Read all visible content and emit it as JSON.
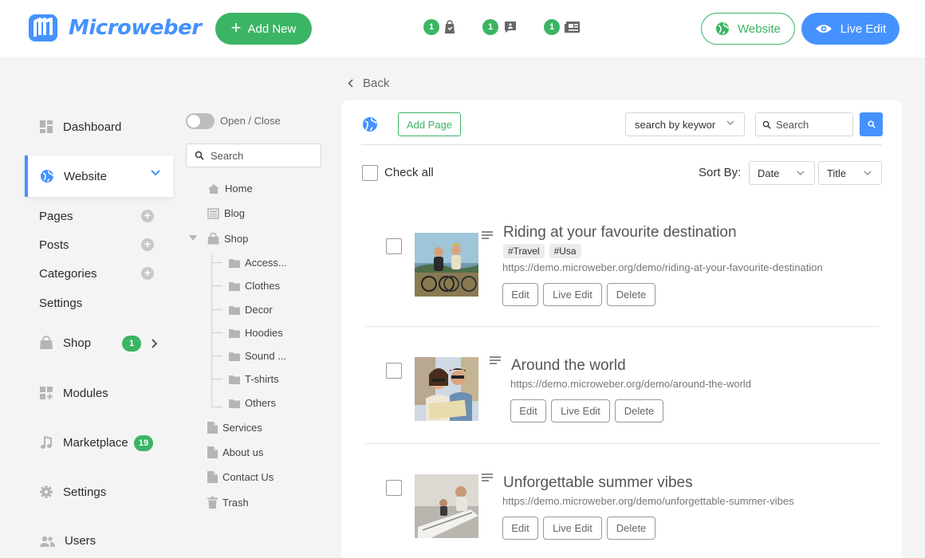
{
  "brand": {
    "name": "Microweber",
    "color": "#4592ff"
  },
  "topbar": {
    "add_new_label": "Add New",
    "notifications": [
      {
        "count": "1",
        "icon": "shop-bag-icon"
      },
      {
        "count": "1",
        "icon": "comment-icon"
      },
      {
        "count": "1",
        "icon": "newspaper-icon"
      }
    ],
    "website_label": "Website",
    "live_edit_label": "Live Edit"
  },
  "sidebar": {
    "dashboard": "Dashboard",
    "website": "Website",
    "website_sub": {
      "pages": "Pages",
      "posts": "Posts",
      "categories": "Categories",
      "settings": "Settings"
    },
    "shop": "Shop",
    "shop_badge": "1",
    "modules": "Modules",
    "marketplace": "Marketplace",
    "marketplace_badge": "19",
    "settings": "Settings",
    "users": "Users"
  },
  "tree": {
    "toggle_label": "Open / Close",
    "search_placeholder": "Search",
    "items": {
      "home": "Home",
      "blog": "Blog",
      "shop": "Shop",
      "access": "Access...",
      "clothes": "Clothes",
      "decor": "Decor",
      "hoodies": "Hoodies",
      "sound": "Sound ...",
      "tshirts": "T-shirts",
      "others": "Others",
      "services": "Services",
      "about": "About us",
      "contact": "Contact Us",
      "trash": "Trash"
    }
  },
  "main": {
    "back_label": "Back",
    "add_page_label": "Add Page",
    "keyword_select": "search by keywor",
    "search_placeholder": "Search",
    "check_all_label": "Check all",
    "sort_by_label": "Sort By:",
    "sort_date": "Date",
    "sort_title": "Title",
    "posts": [
      {
        "title": "Riding at your favourite destination",
        "tags": [
          "#Travel",
          "#Usa"
        ],
        "url": "https://demo.microweber.org/demo/riding-at-your-favourite-destination",
        "edit": "Edit",
        "live_edit": "Live Edit",
        "delete": "Delete"
      },
      {
        "title": "Around the world",
        "url": "https://demo.microweber.org/demo/around-the-world",
        "edit": "Edit",
        "live_edit": "Live Edit",
        "delete": "Delete"
      },
      {
        "title": "Unforgettable summer vibes",
        "url": "https://demo.microweber.org/demo/unforgettable-summer-vibes",
        "edit": "Edit",
        "live_edit": "Live Edit",
        "delete": "Delete"
      }
    ]
  },
  "colors": {
    "green": "#3bb563",
    "blue": "#4592ff"
  }
}
